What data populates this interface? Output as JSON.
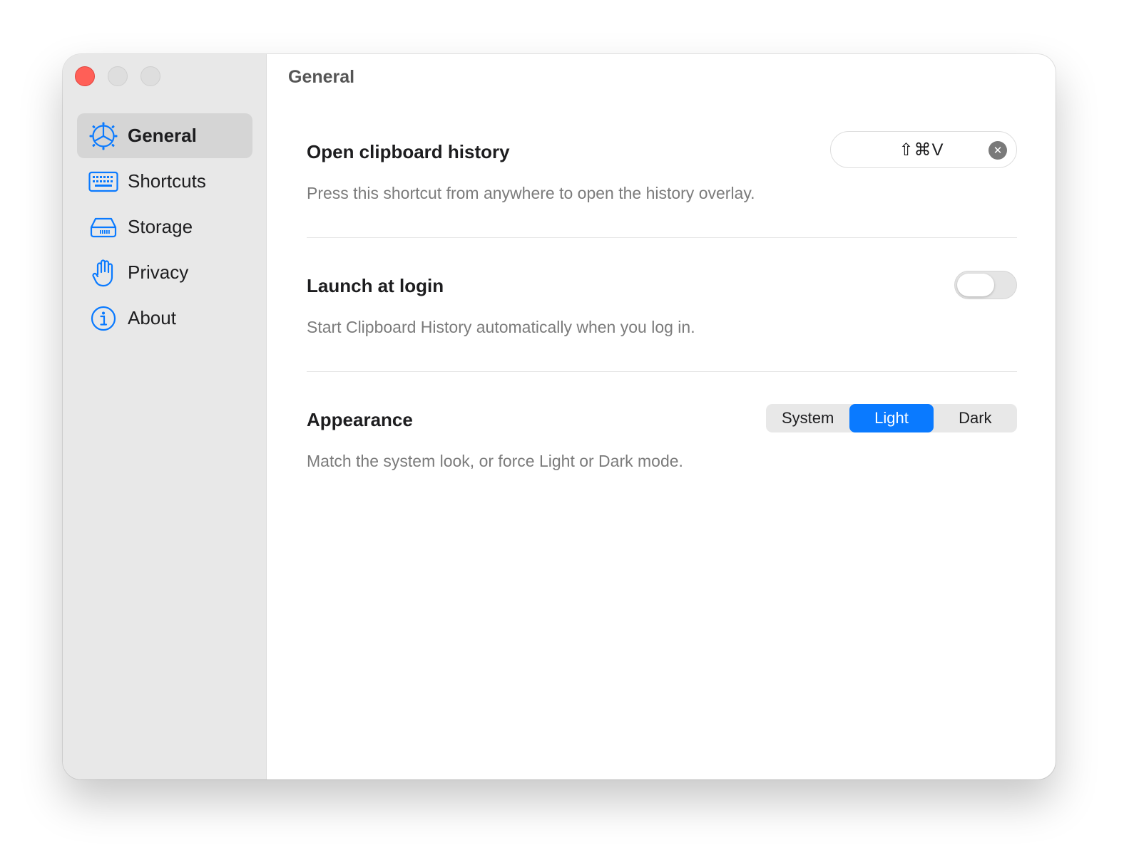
{
  "window": {
    "title": "General"
  },
  "sidebar": {
    "items": [
      {
        "label": "General",
        "icon": "gear-icon",
        "active": true
      },
      {
        "label": "Shortcuts",
        "icon": "keyboard-icon",
        "active": false
      },
      {
        "label": "Storage",
        "icon": "drive-icon",
        "active": false
      },
      {
        "label": "Privacy",
        "icon": "hand-icon",
        "active": false
      },
      {
        "label": "About",
        "icon": "info-icon",
        "active": false
      }
    ]
  },
  "settings": {
    "clipboard": {
      "title": "Open clipboard history",
      "description": "Press this shortcut from anywhere to open the history overlay.",
      "shortcut": "⇧⌘V",
      "clear_glyph": "✕"
    },
    "launch": {
      "title": "Launch at login",
      "description": "Start Clipboard History automatically when you log in.",
      "enabled": false
    },
    "appearance": {
      "title": "Appearance",
      "description": "Match the system look, or force Light or Dark mode.",
      "options": [
        "System",
        "Light",
        "Dark"
      ],
      "selected": "Light"
    }
  },
  "colors": {
    "accent": "#0a7aff",
    "close": "#ff5f57",
    "sidebar_bg": "#e8e8e8"
  }
}
